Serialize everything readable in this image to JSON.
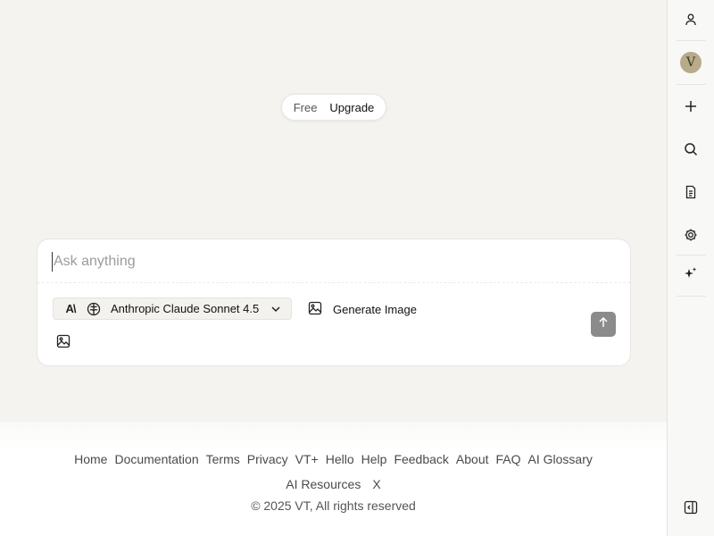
{
  "plan": {
    "free_label": "Free",
    "upgrade_label": "Upgrade"
  },
  "composer": {
    "placeholder": "Ask anything",
    "model_label": "Anthropic Claude Sonnet 4.5",
    "generate_image_label": "Generate Image"
  },
  "footer": {
    "links_row1": [
      "Home",
      "Documentation",
      "Terms",
      "Privacy",
      "VT+",
      "Hello",
      "Help",
      "Feedback",
      "About",
      "FAQ",
      "AI Glossary"
    ],
    "links_row2": [
      "AI Resources",
      "X"
    ],
    "copyright": "© 2025 VT, All rights reserved"
  },
  "sidebar": {
    "avatar_letter": "V",
    "icons": [
      "user-icon",
      "avatar",
      "plus-icon",
      "search-icon",
      "document-icon",
      "gear-icon",
      "sparkles-icon",
      "sidebar-toggle-icon"
    ]
  },
  "colors": {
    "background": "#f4f3f0",
    "send_button": "#8b8b8b",
    "avatar": "#b8ab8a"
  }
}
